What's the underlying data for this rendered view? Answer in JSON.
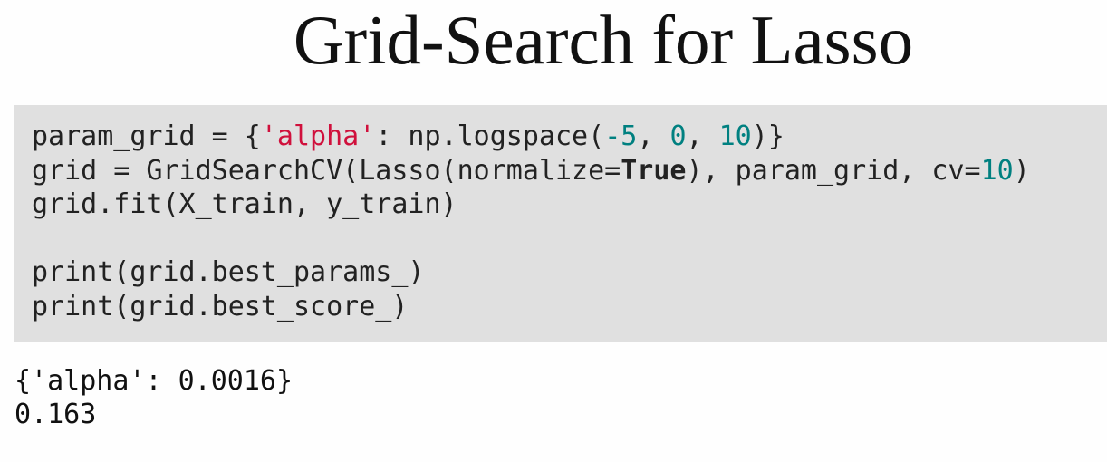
{
  "title": "Grid-Search for Lasso",
  "code": {
    "lines": [
      [
        {
          "t": "param_grid = {",
          "k": "plain"
        },
        {
          "t": "'alpha'",
          "k": "str"
        },
        {
          "t": ": np.logspace(",
          "k": "plain"
        },
        {
          "t": "-5",
          "k": "num"
        },
        {
          "t": ", ",
          "k": "plain"
        },
        {
          "t": "0",
          "k": "num"
        },
        {
          "t": ", ",
          "k": "plain"
        },
        {
          "t": "10",
          "k": "num"
        },
        {
          "t": ")}",
          "k": "plain"
        }
      ],
      [
        {
          "t": "grid = GridSearchCV(Lasso(normalize=",
          "k": "plain"
        },
        {
          "t": "True",
          "k": "kw"
        },
        {
          "t": "), param_grid, cv=",
          "k": "plain"
        },
        {
          "t": "10",
          "k": "num"
        },
        {
          "t": ")",
          "k": "plain"
        }
      ],
      [
        {
          "t": "grid.fit(X_train, y_train)",
          "k": "plain"
        }
      ],
      [],
      [
        {
          "t": "print(grid.best_params_)",
          "k": "plain"
        }
      ],
      [
        {
          "t": "print(grid.best_score_)",
          "k": "plain"
        }
      ]
    ]
  },
  "output": {
    "lines": [
      "{'alpha': 0.0016}",
      "0.163"
    ]
  },
  "colors": {
    "code_background": "#e0e0e0",
    "string": "#d0103c",
    "number": "#008080"
  }
}
